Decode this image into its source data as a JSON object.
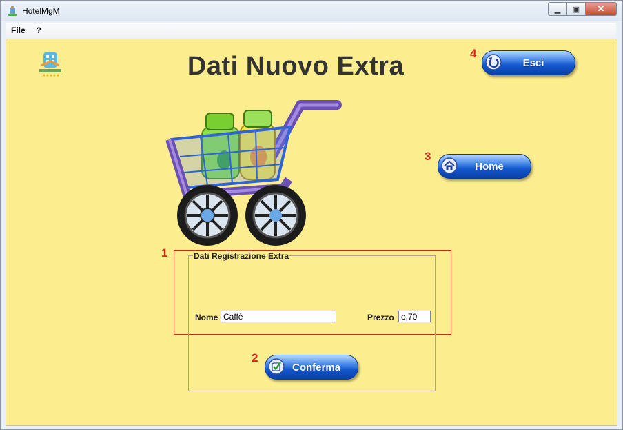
{
  "window": {
    "title": "HotelMgM"
  },
  "menu": {
    "items": [
      "File",
      "?"
    ]
  },
  "header": {
    "title": "Dati Nuovo Extra"
  },
  "buttons": {
    "exit": "Esci",
    "home": "Home",
    "confirm": "Conferma"
  },
  "annotations": {
    "one": "1",
    "two": "2",
    "three": "3",
    "four": "4"
  },
  "form": {
    "group_title": "Dati Registrazione Extra",
    "name_label": "Nome",
    "name_value": "Caffè",
    "price_label": "Prezzo",
    "price_value": "o,70"
  },
  "colors": {
    "content_bg": "#fced8f",
    "button_blue": "#1458cf",
    "annotation_red": "#d9261c",
    "title_text": "#333333"
  },
  "icons": [
    "app-icon",
    "hotel-logo",
    "shopping-cart-illustration",
    "back-arrow-icon",
    "home-icon",
    "checkmark-icon"
  ]
}
